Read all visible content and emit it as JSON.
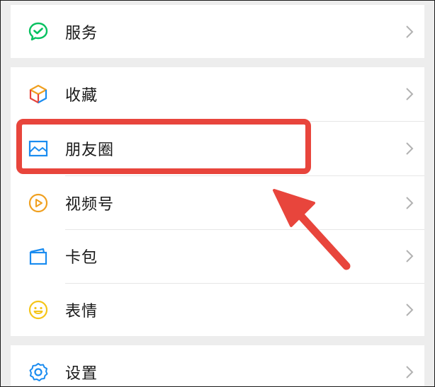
{
  "menu": {
    "services": {
      "label": "服务",
      "icon": "checkmark-circle-icon",
      "color": "#07c160"
    },
    "favorites": {
      "label": "收藏",
      "icon": "cube-icon"
    },
    "moments": {
      "label": "朋友圈",
      "icon": "picture-icon",
      "color": "#1a8cf0"
    },
    "channels": {
      "label": "视频号",
      "icon": "play-circle-icon",
      "color": "#f0a020"
    },
    "cards": {
      "label": "卡包",
      "icon": "wallet-icon",
      "color": "#1a8cf0"
    },
    "stickers": {
      "label": "表情",
      "icon": "smiley-icon",
      "color": "#f5c518"
    },
    "settings": {
      "label": "设置",
      "icon": "gear-icon",
      "color": "#1a8cf0"
    }
  },
  "annotation": {
    "highlight_color": "#e8453c",
    "arrow_color": "#e8453c"
  },
  "chevron_color": "#b2b2b2"
}
